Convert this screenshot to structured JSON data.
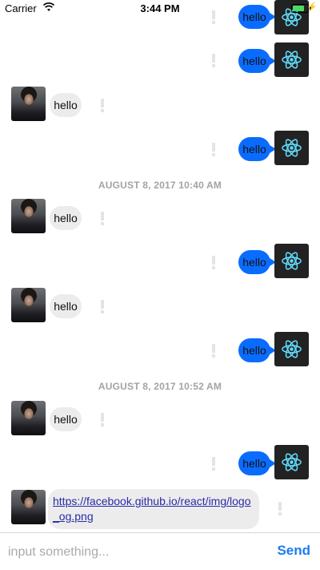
{
  "status_bar": {
    "carrier": "Carrier",
    "time": "3:44 PM",
    "battery_level": 0.8
  },
  "dividers": [
    "AUGUST 8, 2017 10:40 AM",
    "AUGUST 8, 2017 10:52 AM"
  ],
  "messages": [
    {
      "from": "me",
      "text": "hello"
    },
    {
      "from": "me",
      "text": "hello"
    },
    {
      "from": "other",
      "text": "hello"
    },
    {
      "from": "me",
      "text": "hello"
    },
    {
      "from": "other",
      "text": "hello"
    },
    {
      "from": "me",
      "text": "hello"
    },
    {
      "from": "other",
      "text": "hello"
    },
    {
      "from": "me",
      "text": "hello"
    },
    {
      "from": "other",
      "text": "hello"
    },
    {
      "from": "me",
      "text": "hello"
    },
    {
      "from": "other",
      "type": "link",
      "text": "https://facebook.github.io/react/img/logo_og.png"
    }
  ],
  "composer": {
    "placeholder": "input something...",
    "send_label": "Send"
  },
  "colors": {
    "outgoing_bubble": "#0a6cff",
    "incoming_bubble": "#ececec",
    "send": "#1a7cf2"
  }
}
